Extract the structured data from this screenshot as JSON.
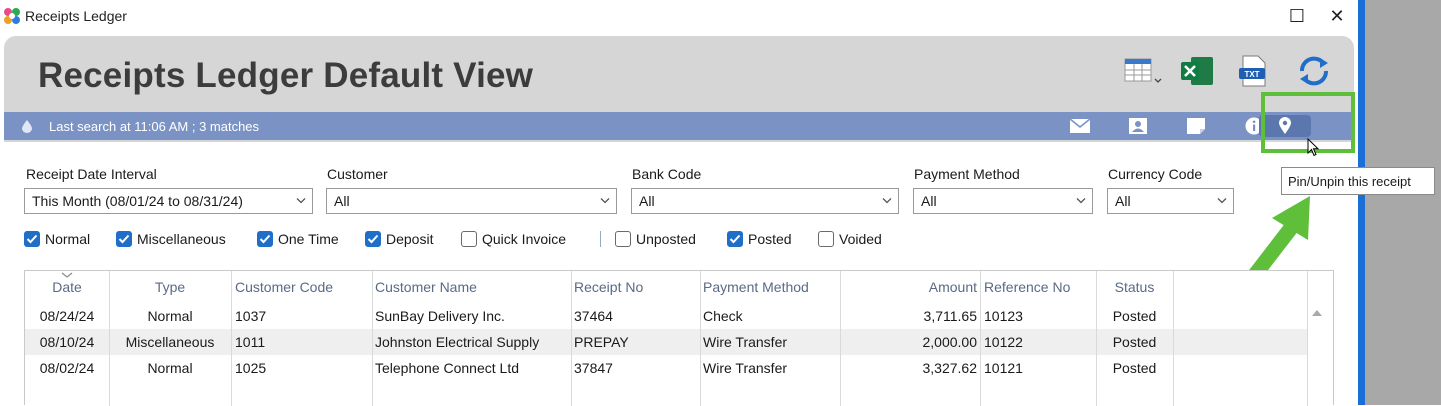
{
  "window": {
    "title": "Receipts Ledger",
    "maximize_symbol": "☐",
    "close_symbol": "✕"
  },
  "header": {
    "title": "Receipts Ledger Default View",
    "toolbar_icons": [
      "columns-menu-icon",
      "excel-export-icon",
      "txt-export-icon",
      "refresh-icon"
    ],
    "txt_badge": "TXT"
  },
  "status_bar": {
    "text": "Last search at 11:06 AM ; 3 matches",
    "icons": [
      "email-icon",
      "contact-card-icon",
      "note-icon",
      "info-icon",
      "pin-icon"
    ]
  },
  "tooltip": "Pin/Unpin this receipt",
  "filters": {
    "receipt_date_interval": {
      "label": "Receipt Date Interval",
      "value": "This Month (08/01/24 to 08/31/24)"
    },
    "customer": {
      "label": "Customer",
      "value": "All"
    },
    "bank_code": {
      "label": "Bank Code",
      "value": "All"
    },
    "payment_method": {
      "label": "Payment Method",
      "value": "All"
    },
    "currency_code": {
      "label": "Currency Code",
      "value": "All"
    }
  },
  "checkboxes": [
    {
      "label": "Normal",
      "checked": true
    },
    {
      "label": "Miscellaneous",
      "checked": true
    },
    {
      "label": "One Time",
      "checked": true
    },
    {
      "label": "Deposit",
      "checked": true
    },
    {
      "label": "Quick Invoice",
      "checked": false
    },
    {
      "label": "Unposted",
      "checked": false
    },
    {
      "label": "Posted",
      "checked": true
    },
    {
      "label": "Voided",
      "checked": false
    }
  ],
  "table": {
    "columns": [
      "Date",
      "Type",
      "Customer Code",
      "Customer Name",
      "Receipt No",
      "Payment Method",
      "Amount",
      "Reference No",
      "Status"
    ],
    "rows": [
      [
        "08/24/24",
        "Normal",
        "1037",
        "SunBay Delivery Inc.",
        "37464",
        "Check",
        "3,711.65",
        "10123",
        "Posted"
      ],
      [
        "08/10/24",
        "Miscellaneous",
        "1011",
        "Johnston Electrical Supply",
        "PREPAY",
        "Wire Transfer",
        "2,000.00",
        "10122",
        "Posted"
      ],
      [
        "08/02/24",
        "Normal",
        "1025",
        "Telephone Connect Ltd",
        "37847",
        "Wire Transfer",
        "3,327.62",
        "10121",
        "Posted"
      ]
    ]
  },
  "colors": {
    "status_bar": "#7b93c4",
    "highlight": "#5fbf3a",
    "checkbox_checked": "#1f6ec7",
    "header_panel": "#d6d6d6"
  }
}
